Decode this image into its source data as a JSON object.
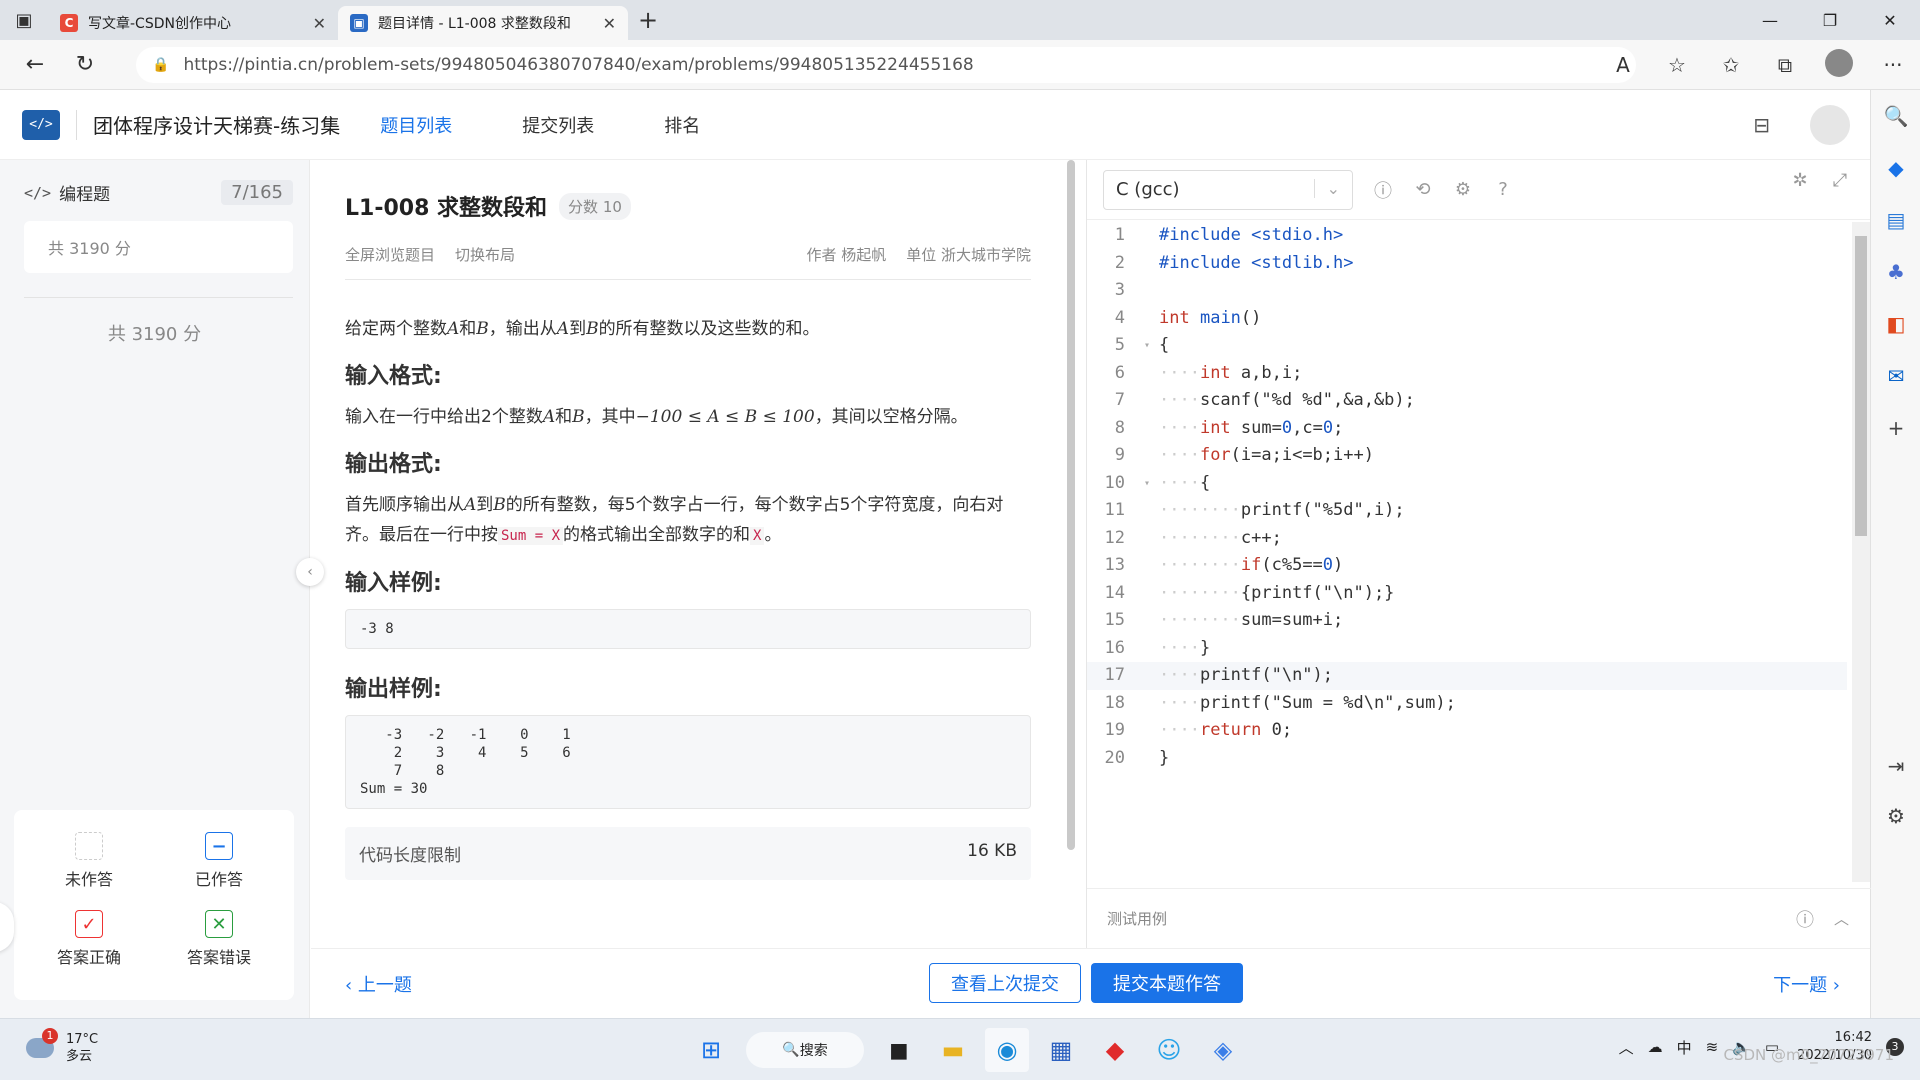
{
  "browser": {
    "tabs": [
      {
        "title": "写文章-CSDN创作中心",
        "favicon": "C",
        "color": "#e84a3a"
      },
      {
        "title": "题目详情 - L1-008 求整数段和",
        "favicon": "▣",
        "color": "#2a6ac4"
      }
    ],
    "url": "https://pintia.cn/problem-sets/994805046380707840/exam/problems/994805135224455168"
  },
  "app": {
    "title": "团体程序设计天梯赛-练习集",
    "nav": [
      "题目列表",
      "提交列表",
      "排名"
    ]
  },
  "sidebar": {
    "heading": "编程题",
    "count": "7/165",
    "score_card": "共 3190 分",
    "total": "共 3190 分",
    "legend": {
      "unanswered": "未作答",
      "answered": "已作答",
      "correct": "答案正确",
      "wrong": "答案错误"
    }
  },
  "problem": {
    "title": "L1-008 求整数段和",
    "score": "分数 10",
    "fullscreen": "全屏浏览题目",
    "switch_layout": "切换布局",
    "author": "作者 杨起帆",
    "unit": "单位 浙大城市学院",
    "desc_a": "给定两个整数",
    "desc_b": "和",
    "desc_c": "，输出从",
    "desc_d": "到",
    "desc_e": "的所有整数以及这些数的和。",
    "var_a": "A",
    "var_b": "B",
    "input_heading": "输入格式:",
    "input_text_a": "输入在一行中给出2个整数",
    "input_text_b": "，其中",
    "input_math": "−100 ≤ A ≤ B ≤ 100",
    "input_text_c": "，其间以空格分隔。",
    "output_heading": "输出格式:",
    "output_text_a": "首先顺序输出从",
    "output_text_b": "的所有整数，每5个数字占一行，每个数字占5个字符宽度，向右对齐。最后在一行中按",
    "output_code1": "Sum = X",
    "output_text_c": "的格式输出全部数字的和",
    "output_code2": "X",
    "output_text_d": "。",
    "sample_in_heading": "输入样例:",
    "sample_in": "-3 8",
    "sample_out_heading": "输出样例:",
    "sample_out": "   -3   -2   -1    0    1\n    2    3    4    5    6\n    7    8\nSum = 30",
    "limit_label": "代码长度限制",
    "limit_value": "16 KB"
  },
  "editor": {
    "language": "C (gcc)",
    "lines": [
      "#include <stdio.h>",
      "#include <stdlib.h>",
      "",
      "int main()",
      "{",
      "    int a,b,i;",
      "    scanf(\"%d %d\",&a,&b);",
      "    int sum=0,c=0;",
      "    for(i=a;i<=b;i++)",
      "    {",
      "        printf(\"%5d\",i);",
      "        c++;",
      "        if(c%5==0)",
      "        {printf(\"\\n\");}",
      "        sum=sum+i;",
      "    }",
      "    printf(\"\\n\");",
      "    printf(\"Sum = %d\\n\",sum);",
      "    return 0;",
      "}"
    ],
    "test_label": "测试用例"
  },
  "actions": {
    "prev": "上一题",
    "view_last": "查看上次提交",
    "submit": "提交本题作答",
    "next": "下一题"
  },
  "taskbar": {
    "temp": "17°C",
    "weather": "多云",
    "badge": "1",
    "search": "搜索",
    "ime": "中",
    "time": "16:42",
    "date": "2022/10/30",
    "notif": "3"
  },
  "watermark": "CSDN @m0_70723971"
}
